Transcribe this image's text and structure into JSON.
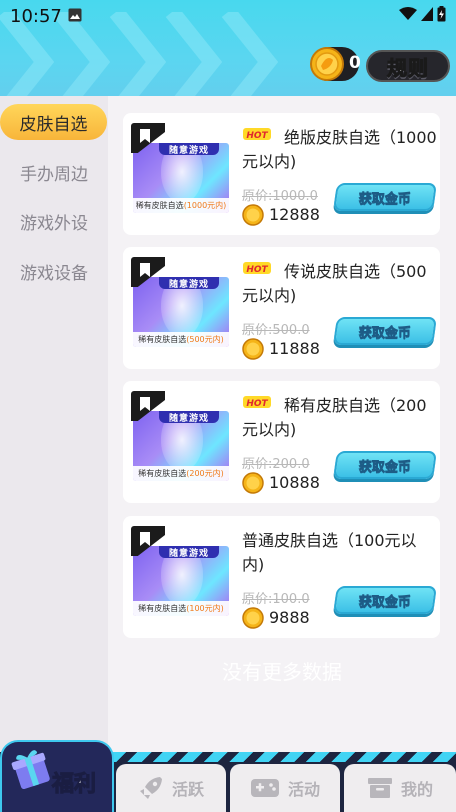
{
  "status": {
    "time": "10:57"
  },
  "header": {
    "coin_count": "0",
    "rules_label": "规则"
  },
  "sidebar": {
    "items": [
      {
        "label": "皮肤自选",
        "active": true
      },
      {
        "label": "手办周边",
        "active": false
      },
      {
        "label": "游戏外设",
        "active": false
      },
      {
        "label": "游戏设备",
        "active": false
      }
    ]
  },
  "products": [
    {
      "title": "绝版皮肤自选（1000元以内)",
      "hot": true,
      "original_price": "原价:1000.0",
      "coin_price": "12888",
      "button_label": "获取金币",
      "thumb_banner": "随意游戏",
      "thumb_caption": "稀有皮肤自选",
      "thumb_caption_hl": "(1000元内)"
    },
    {
      "title": "传说皮肤自选（500元以内)",
      "hot": true,
      "original_price": "原价:500.0",
      "coin_price": "11888",
      "button_label": "获取金币",
      "thumb_banner": "随意游戏",
      "thumb_caption": "稀有皮肤自选",
      "thumb_caption_hl": "(500元内)"
    },
    {
      "title": "稀有皮肤自选（200元以内)",
      "hot": true,
      "original_price": "原价:200.0",
      "coin_price": "10888",
      "button_label": "获取金币",
      "thumb_banner": "随意游戏",
      "thumb_caption": "稀有皮肤自选",
      "thumb_caption_hl": "(200元内)"
    },
    {
      "title": "普通皮肤自选（100元以内)",
      "hot": false,
      "original_price": "原价:100.0",
      "coin_price": "9888",
      "button_label": "获取金币",
      "thumb_banner": "随意游戏",
      "thumb_caption": "稀有皮肤自选",
      "thumb_caption_hl": "(100元内)"
    }
  ],
  "no_more_text": "没有更多数据",
  "bottom_nav": {
    "fuli_label": "福利",
    "tabs": [
      {
        "label": "活跃",
        "icon": "rocket-icon"
      },
      {
        "label": "活动",
        "icon": "gamepad-icon"
      },
      {
        "label": "我的",
        "icon": "box-icon"
      }
    ]
  },
  "colors": {
    "header": "#48d8ee",
    "active_tab": "#f8b53a",
    "button": "#3cc0e6",
    "nav_bg": "#1d2540"
  }
}
